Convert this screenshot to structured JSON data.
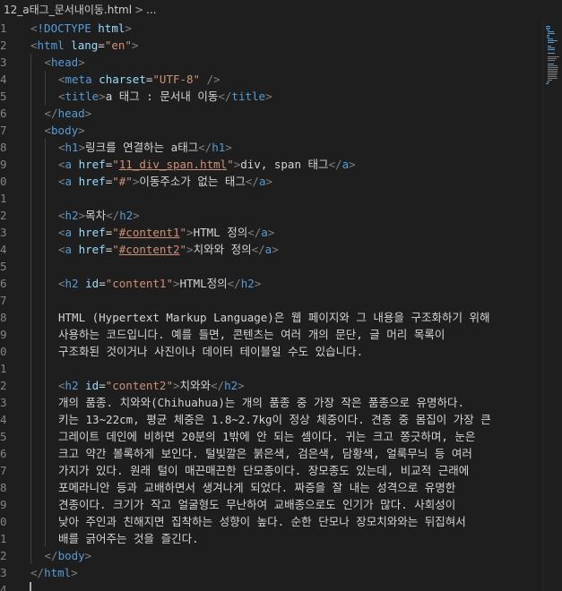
{
  "breadcrumb": {
    "file": "12_a태그_문서내이동.html",
    "separator": ">",
    "more": "..."
  },
  "lines": [
    {
      "num": "1",
      "indent": 0,
      "tokens": [
        [
          "punc",
          "<"
        ],
        [
          "tag",
          "!DOCTYPE"
        ],
        [
          "txt",
          " "
        ],
        [
          "attr",
          "html"
        ],
        [
          "punc",
          ">"
        ]
      ]
    },
    {
      "num": "2",
      "indent": 0,
      "tokens": [
        [
          "punc",
          "<"
        ],
        [
          "tag",
          "html"
        ],
        [
          "txt",
          " "
        ],
        [
          "attr",
          "lang"
        ],
        [
          "txt",
          "="
        ],
        [
          "val",
          "\"en\""
        ],
        [
          "punc",
          ">"
        ]
      ]
    },
    {
      "num": "3",
      "indent": 1,
      "tokens": [
        [
          "punc",
          "<"
        ],
        [
          "tag",
          "head"
        ],
        [
          "punc",
          ">"
        ]
      ]
    },
    {
      "num": "4",
      "indent": 2,
      "tokens": [
        [
          "punc",
          "<"
        ],
        [
          "tag",
          "meta"
        ],
        [
          "txt",
          " "
        ],
        [
          "attr",
          "charset"
        ],
        [
          "txt",
          "="
        ],
        [
          "val",
          "\"UTF-8\""
        ],
        [
          "txt",
          " "
        ],
        [
          "punc",
          "/>"
        ]
      ]
    },
    {
      "num": "5",
      "indent": 2,
      "tokens": [
        [
          "punc",
          "<"
        ],
        [
          "tag",
          "title"
        ],
        [
          "punc",
          ">"
        ],
        [
          "txt",
          "a 태그 : 문서내 이동"
        ],
        [
          "punc",
          "</"
        ],
        [
          "tag",
          "title"
        ],
        [
          "punc",
          ">"
        ]
      ]
    },
    {
      "num": "6",
      "indent": 1,
      "tokens": [
        [
          "punc",
          "</"
        ],
        [
          "tag",
          "head"
        ],
        [
          "punc",
          ">"
        ]
      ]
    },
    {
      "num": "7",
      "indent": 1,
      "tokens": [
        [
          "punc",
          "<"
        ],
        [
          "tag",
          "body"
        ],
        [
          "punc",
          ">"
        ]
      ]
    },
    {
      "num": "8",
      "indent": 2,
      "tokens": [
        [
          "punc",
          "<"
        ],
        [
          "tag",
          "h1"
        ],
        [
          "punc",
          ">"
        ],
        [
          "txt",
          "링크를 연결하는 a태그"
        ],
        [
          "punc",
          "</"
        ],
        [
          "tag",
          "h1"
        ],
        [
          "punc",
          ">"
        ]
      ]
    },
    {
      "num": "9",
      "indent": 2,
      "tokens": [
        [
          "punc",
          "<"
        ],
        [
          "tag",
          "a"
        ],
        [
          "txt",
          " "
        ],
        [
          "attr",
          "href"
        ],
        [
          "txt",
          "="
        ],
        [
          "val",
          "\""
        ],
        [
          "vallink",
          "11_div_span.html"
        ],
        [
          "val",
          "\""
        ],
        [
          "punc",
          ">"
        ],
        [
          "txt",
          "div, span 태그"
        ],
        [
          "punc",
          "</"
        ],
        [
          "tag",
          "a"
        ],
        [
          "punc",
          ">"
        ]
      ]
    },
    {
      "num": "0",
      "indent": 2,
      "tokens": [
        [
          "punc",
          "<"
        ],
        [
          "tag",
          "a"
        ],
        [
          "txt",
          " "
        ],
        [
          "attr",
          "href"
        ],
        [
          "txt",
          "="
        ],
        [
          "val",
          "\"#\""
        ],
        [
          "punc",
          ">"
        ],
        [
          "txt",
          "이동주소가 없는 태그"
        ],
        [
          "punc",
          "</"
        ],
        [
          "tag",
          "a"
        ],
        [
          "punc",
          ">"
        ]
      ]
    },
    {
      "num": "1",
      "indent": 2,
      "tokens": []
    },
    {
      "num": "2",
      "indent": 2,
      "tokens": [
        [
          "punc",
          "<"
        ],
        [
          "tag",
          "h2"
        ],
        [
          "punc",
          ">"
        ],
        [
          "txt",
          "목차"
        ],
        [
          "punc",
          "</"
        ],
        [
          "tag",
          "h2"
        ],
        [
          "punc",
          ">"
        ]
      ]
    },
    {
      "num": "3",
      "indent": 2,
      "tokens": [
        [
          "punc",
          "<"
        ],
        [
          "tag",
          "a"
        ],
        [
          "txt",
          " "
        ],
        [
          "attr",
          "href"
        ],
        [
          "txt",
          "="
        ],
        [
          "val",
          "\""
        ],
        [
          "vallink",
          "#content1"
        ],
        [
          "val",
          "\""
        ],
        [
          "punc",
          ">"
        ],
        [
          "txt",
          "HTML 정의"
        ],
        [
          "punc",
          "</"
        ],
        [
          "tag",
          "a"
        ],
        [
          "punc",
          ">"
        ]
      ]
    },
    {
      "num": "4",
      "indent": 2,
      "tokens": [
        [
          "punc",
          "<"
        ],
        [
          "tag",
          "a"
        ],
        [
          "txt",
          " "
        ],
        [
          "attr",
          "href"
        ],
        [
          "txt",
          "="
        ],
        [
          "val",
          "\""
        ],
        [
          "vallink",
          "#content2"
        ],
        [
          "val",
          "\""
        ],
        [
          "punc",
          ">"
        ],
        [
          "txt",
          "치와와 정의"
        ],
        [
          "punc",
          "</"
        ],
        [
          "tag",
          "a"
        ],
        [
          "punc",
          ">"
        ]
      ]
    },
    {
      "num": "5",
      "indent": 2,
      "tokens": []
    },
    {
      "num": "6",
      "indent": 2,
      "tokens": [
        [
          "punc",
          "<"
        ],
        [
          "tag",
          "h2"
        ],
        [
          "txt",
          " "
        ],
        [
          "attr",
          "id"
        ],
        [
          "txt",
          "="
        ],
        [
          "val",
          "\"content1\""
        ],
        [
          "punc",
          ">"
        ],
        [
          "txt",
          "HTML정의"
        ],
        [
          "punc",
          "</"
        ],
        [
          "tag",
          "h2"
        ],
        [
          "punc",
          ">"
        ]
      ]
    },
    {
      "num": "7",
      "indent": 2,
      "tokens": []
    },
    {
      "num": "8",
      "indent": 2,
      "tokens": [
        [
          "txt",
          "HTML (Hypertext Markup Language)은 웹 페이지와 그 내용을 구조화하기 위해"
        ]
      ]
    },
    {
      "num": "9",
      "indent": 2,
      "tokens": [
        [
          "txt",
          "사용하는 코드입니다. 예를 들면, 콘텐츠는 여러 개의 문단, 글 머리 목록이"
        ]
      ]
    },
    {
      "num": "0",
      "indent": 2,
      "tokens": [
        [
          "txt",
          "구조화된 것이거나 사진이나 데이터 테이블일 수도 있습니다."
        ]
      ]
    },
    {
      "num": "1",
      "indent": 2,
      "tokens": []
    },
    {
      "num": "2",
      "indent": 2,
      "tokens": [
        [
          "punc",
          "<"
        ],
        [
          "tag",
          "h2"
        ],
        [
          "txt",
          " "
        ],
        [
          "attr",
          "id"
        ],
        [
          "txt",
          "="
        ],
        [
          "val",
          "\"content2\""
        ],
        [
          "punc",
          ">"
        ],
        [
          "txt",
          "치와와"
        ],
        [
          "punc",
          "</"
        ],
        [
          "tag",
          "h2"
        ],
        [
          "punc",
          ">"
        ]
      ]
    },
    {
      "num": "3",
      "indent": 2,
      "tokens": [
        [
          "txt",
          "개의 품종. 치와와(Chihuahua)는 개의 품종 중 가장 작은 품종으로 유명하다."
        ]
      ]
    },
    {
      "num": "4",
      "indent": 2,
      "tokens": [
        [
          "txt",
          "키는 13~22cm, 평균 체중은 1.8~2.7kg이 정상 체중이다. 견종 중 몸집이 가장 큰"
        ]
      ]
    },
    {
      "num": "5",
      "indent": 2,
      "tokens": [
        [
          "txt",
          "그레이트 데인에 비하면 20분의 1밖에 안 되는 셈이다. 귀는 크고 쫑긋하며, 눈은"
        ]
      ]
    },
    {
      "num": "6",
      "indent": 2,
      "tokens": [
        [
          "txt",
          "크고 약간 볼록하게 보인다. 털빛깔은 붉은색, 검은색, 담황색, 얼룩무늬 등 여러"
        ]
      ]
    },
    {
      "num": "7",
      "indent": 2,
      "tokens": [
        [
          "txt",
          "가지가 있다. 원래 털이 매끈매끈한 단모종이다. 장모종도 있는데, 비교적 근래에"
        ]
      ]
    },
    {
      "num": "8",
      "indent": 2,
      "tokens": [
        [
          "txt",
          "포메라니안 등과 교배하면서 생겨나게 되었다. 짜증을 잘 내는 성격으로 유명한"
        ]
      ]
    },
    {
      "num": "9",
      "indent": 2,
      "tokens": [
        [
          "txt",
          "견종이다. 크기가 작고 얼굴형도 무난하여 교배종으로도 인기가 많다. 사회성이"
        ]
      ]
    },
    {
      "num": "0",
      "indent": 2,
      "tokens": [
        [
          "txt",
          "낮아 주인과 친해지면 집착하는 성향이 높다. 순한 단모나 장모치와와는 뒤집혀서"
        ]
      ]
    },
    {
      "num": "1",
      "indent": 2,
      "tokens": [
        [
          "txt",
          "배를 긁어주는 것을 즐긴다."
        ]
      ]
    },
    {
      "num": "2",
      "indent": 1,
      "tokens": [
        [
          "punc",
          "</"
        ],
        [
          "tag",
          "body"
        ],
        [
          "punc",
          ">"
        ]
      ]
    },
    {
      "num": "3",
      "indent": 0,
      "tokens": [
        [
          "punc",
          "</"
        ],
        [
          "tag",
          "html"
        ],
        [
          "punc",
          ">"
        ]
      ]
    },
    {
      "num": "4",
      "indent": 0,
      "tokens": []
    }
  ],
  "colors": {
    "background": "#1e1e1e",
    "tag": "#569cd6",
    "punctuation": "#808080",
    "attribute": "#9cdcfe",
    "string": "#ce9178",
    "text": "#d4d4d4",
    "line_number": "#858585"
  }
}
